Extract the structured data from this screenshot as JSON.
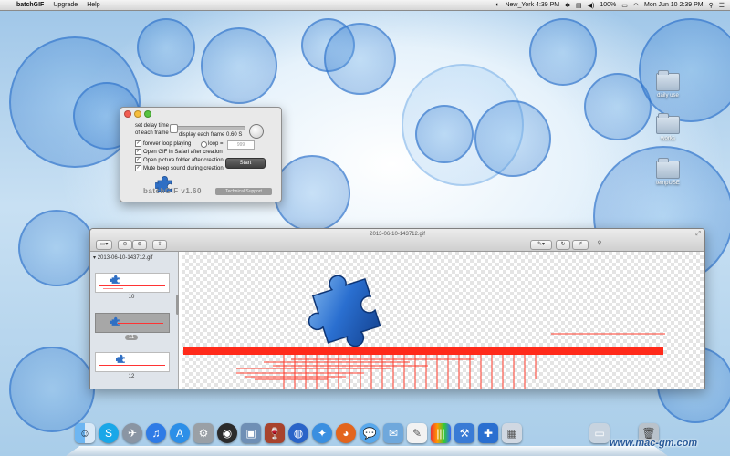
{
  "menubar": {
    "apple_symbol": "",
    "app_name": "batchGIF",
    "menus": [
      "Upgrade",
      "Help"
    ],
    "clock_city": "New_York 4:39 PM",
    "battery": "100%",
    "datetime": "Mon Jun 10  2:39 PM"
  },
  "batchgif": {
    "delay_label_1": "set delay time",
    "delay_label_2": "of each frame",
    "display_frame": "display each frame 0.60 S",
    "forever_loop": "forever loop playing",
    "loop_label": "loop =",
    "loop_placeholder": "999",
    "open_safari": "Open GIF in Safari after creation",
    "open_folder": "Open picture folder after creation",
    "mute_beep": "Mute beep sound during creation",
    "start_button": "Start",
    "title": "batchGIF v1.60",
    "support_button": "Technical Support"
  },
  "preview": {
    "window_title": "2013-06-10-143712.gif",
    "sidebar_header": "2013-06-10-143712.gif",
    "thumbnails": [
      {
        "label": "10"
      },
      {
        "label": "11"
      },
      {
        "label": "12"
      }
    ]
  },
  "desktop_icons": [
    {
      "label": "daily use"
    },
    {
      "label": "works"
    },
    {
      "label": "tempUSE"
    }
  ],
  "dock_icons": [
    "finder-icon",
    "skype-icon",
    "launchpad-icon",
    "itunes-icon",
    "app-store-icon",
    "system-preferences-icon",
    "dashboard-icon",
    "preview-icon",
    "wine-icon",
    "chrome-icon",
    "safari-icon",
    "firefox-icon",
    "messages-icon",
    "mail-icon",
    "textedit-icon",
    "crayons-icon",
    "xcode-icon",
    "batchgif-icon",
    "photo-icon",
    "folders-icon",
    "trash-icon"
  ],
  "watermark": "www.mac-gm.com"
}
